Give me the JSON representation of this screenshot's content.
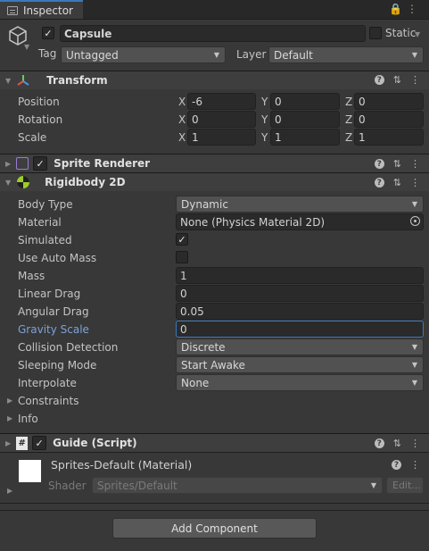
{
  "tab": {
    "title": "Inspector"
  },
  "object": {
    "name": "Capsule",
    "active": true,
    "static_label": "Static",
    "tag_label": "Tag",
    "tag_value": "Untagged",
    "layer_label": "Layer",
    "layer_value": "Default"
  },
  "transform": {
    "title": "Transform",
    "position_label": "Position",
    "rotation_label": "Rotation",
    "scale_label": "Scale",
    "position": {
      "x": "-6",
      "y": "0",
      "z": "0"
    },
    "rotation": {
      "x": "0",
      "y": "0",
      "z": "0"
    },
    "scale": {
      "x": "1",
      "y": "1",
      "z": "1"
    },
    "axis": {
      "x": "X",
      "y": "Y",
      "z": "Z"
    }
  },
  "sprite_renderer": {
    "title": "Sprite Renderer",
    "enabled": true
  },
  "rigidbody": {
    "title": "Rigidbody 2D",
    "body_type_label": "Body Type",
    "body_type": "Dynamic",
    "material_label": "Material",
    "material": "None (Physics Material 2D)",
    "simulated_label": "Simulated",
    "simulated": true,
    "auto_mass_label": "Use Auto Mass",
    "auto_mass": false,
    "mass_label": "Mass",
    "mass": "1",
    "linear_drag_label": "Linear Drag",
    "linear_drag": "0",
    "angular_drag_label": "Angular Drag",
    "angular_drag": "0.05",
    "gravity_label": "Gravity Scale",
    "gravity": "0",
    "collision_label": "Collision Detection",
    "collision": "Discrete",
    "sleeping_label": "Sleeping Mode",
    "sleeping": "Start Awake",
    "interpolate_label": "Interpolate",
    "interpolate": "None",
    "constraints_label": "Constraints",
    "info_label": "Info"
  },
  "guide": {
    "title": "Guide (Script)",
    "enabled": true
  },
  "material": {
    "title": "Sprites-Default (Material)",
    "shader_label": "Shader",
    "shader": "Sprites/Default",
    "edit_label": "Edit..."
  },
  "add_component": "Add Component",
  "colors": {
    "accent": "#3a79bb",
    "focus_label": "#7ba2d8"
  }
}
